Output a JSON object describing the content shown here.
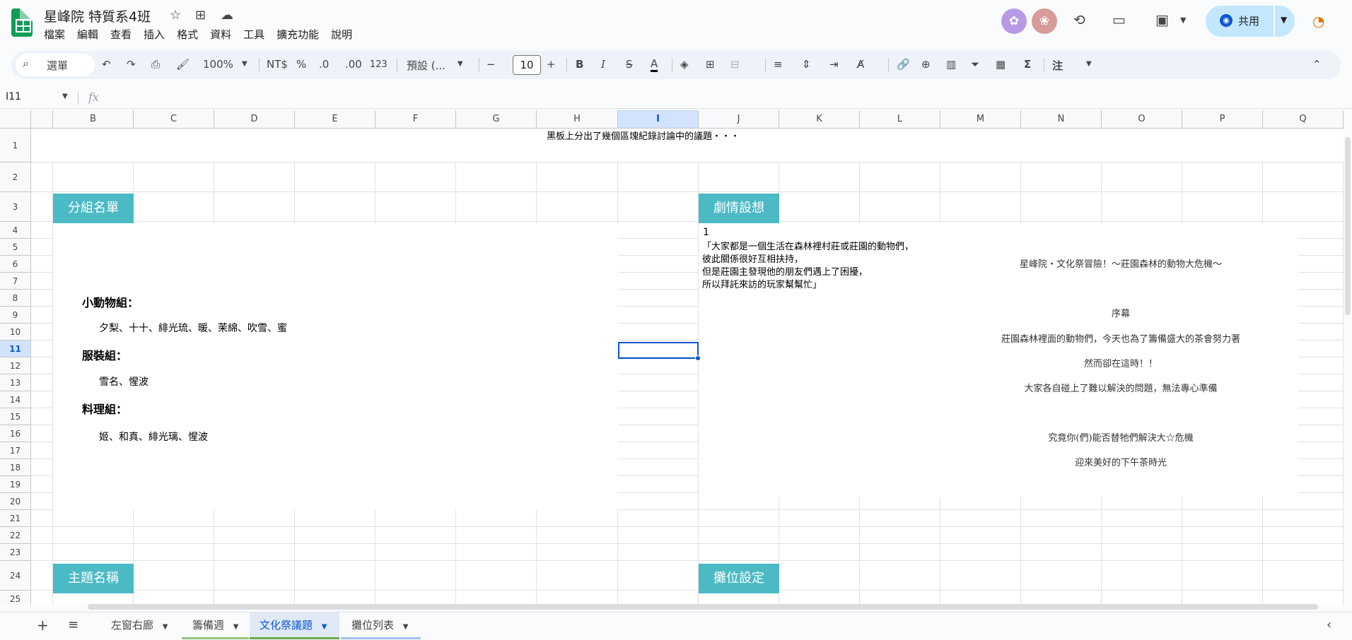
{
  "doc": {
    "title": "星峰院 特質系4班",
    "menu": [
      "檔案",
      "編輯",
      "查看",
      "插入",
      "格式",
      "資料",
      "工具",
      "擴充功能",
      "說明"
    ],
    "share_label": "共用"
  },
  "toolbar": {
    "search_label": "選單",
    "zoom": "100%",
    "currency": "NT$",
    "percent": "%",
    "dec_decrease": ".0",
    "dec_increase": ".00",
    "number_format": "123",
    "font": "預設 (...",
    "font_size": "10",
    "bold": "B",
    "italic": "I",
    "strike": "S",
    "text_color": "A",
    "sigma": "Σ",
    "ann": "注"
  },
  "formula": {
    "namebox": "I11",
    "fx": "fx",
    "value": ""
  },
  "grid": {
    "columns": [
      "B",
      "C",
      "D",
      "E",
      "F",
      "G",
      "H",
      "I",
      "J",
      "K",
      "L",
      "M",
      "N",
      "O",
      "P",
      "Q"
    ],
    "selected_column": "I",
    "rows": [
      "1",
      "2",
      "3",
      "4",
      "5",
      "6",
      "7",
      "8",
      "9",
      "10",
      "11",
      "12",
      "13",
      "14",
      "15",
      "16",
      "17",
      "18",
      "19",
      "20",
      "21",
      "22",
      "23",
      "24",
      "25"
    ],
    "selected_row": "11",
    "cells": {
      "row1_text": "黑板上分出了幾個區塊紀錄討論中的議題・・・",
      "b3_label": "分組名單",
      "j3_label": "劇情設想",
      "b24_label": "主題名稱",
      "j24_label": "攤位設定",
      "group1_title": "小動物組：",
      "group1_members": "夕梨、十十、緋光琉、暖、茉綿、吹雪、蜜",
      "group2_title": "服裝組：",
      "group2_members": "雪名、惺波",
      "group3_title": "料理組：",
      "group3_members": "姬、和真、緋光璃、惺波",
      "plot_num": "1",
      "plot_line1": "「大家都是一個生活在森林裡村莊或莊園的動物們，",
      "plot_line2": "彼此關係很好互相扶持，",
      "plot_line3": "但是莊園主發現他的朋友們遇上了困擾，",
      "plot_line4": "所以拜託來訪的玩家幫幫忙」",
      "story_title": "星峰院・文化祭冒險！～莊園森林的動物大危機～",
      "story_prologue": "序幕",
      "story_l1": "莊園森林裡面的動物們，今天也為了籌備盛大的茶會努力著",
      "story_l2": "然而卻在這時！！",
      "story_l3": "大家各自碰上了難以解決的問題，無法專心準備",
      "story_l4": "究竟你(們)能否替牠們解決大☆危機",
      "story_l5": "迎來美好的下午茶時光"
    }
  },
  "sheets": [
    {
      "name": "左窗右廊",
      "color": "#ffffff"
    },
    {
      "name": "籌備週",
      "color": "#93c47d"
    },
    {
      "name": "文化祭議題",
      "color": "#6aa84f"
    },
    {
      "name": "攤位列表",
      "color": "#a4c2f4"
    }
  ],
  "colors": {
    "teal": "#4bbac4",
    "accent": "#0b57d0",
    "avatar1": "#b79ae6",
    "avatar2": "#d99a9a"
  }
}
